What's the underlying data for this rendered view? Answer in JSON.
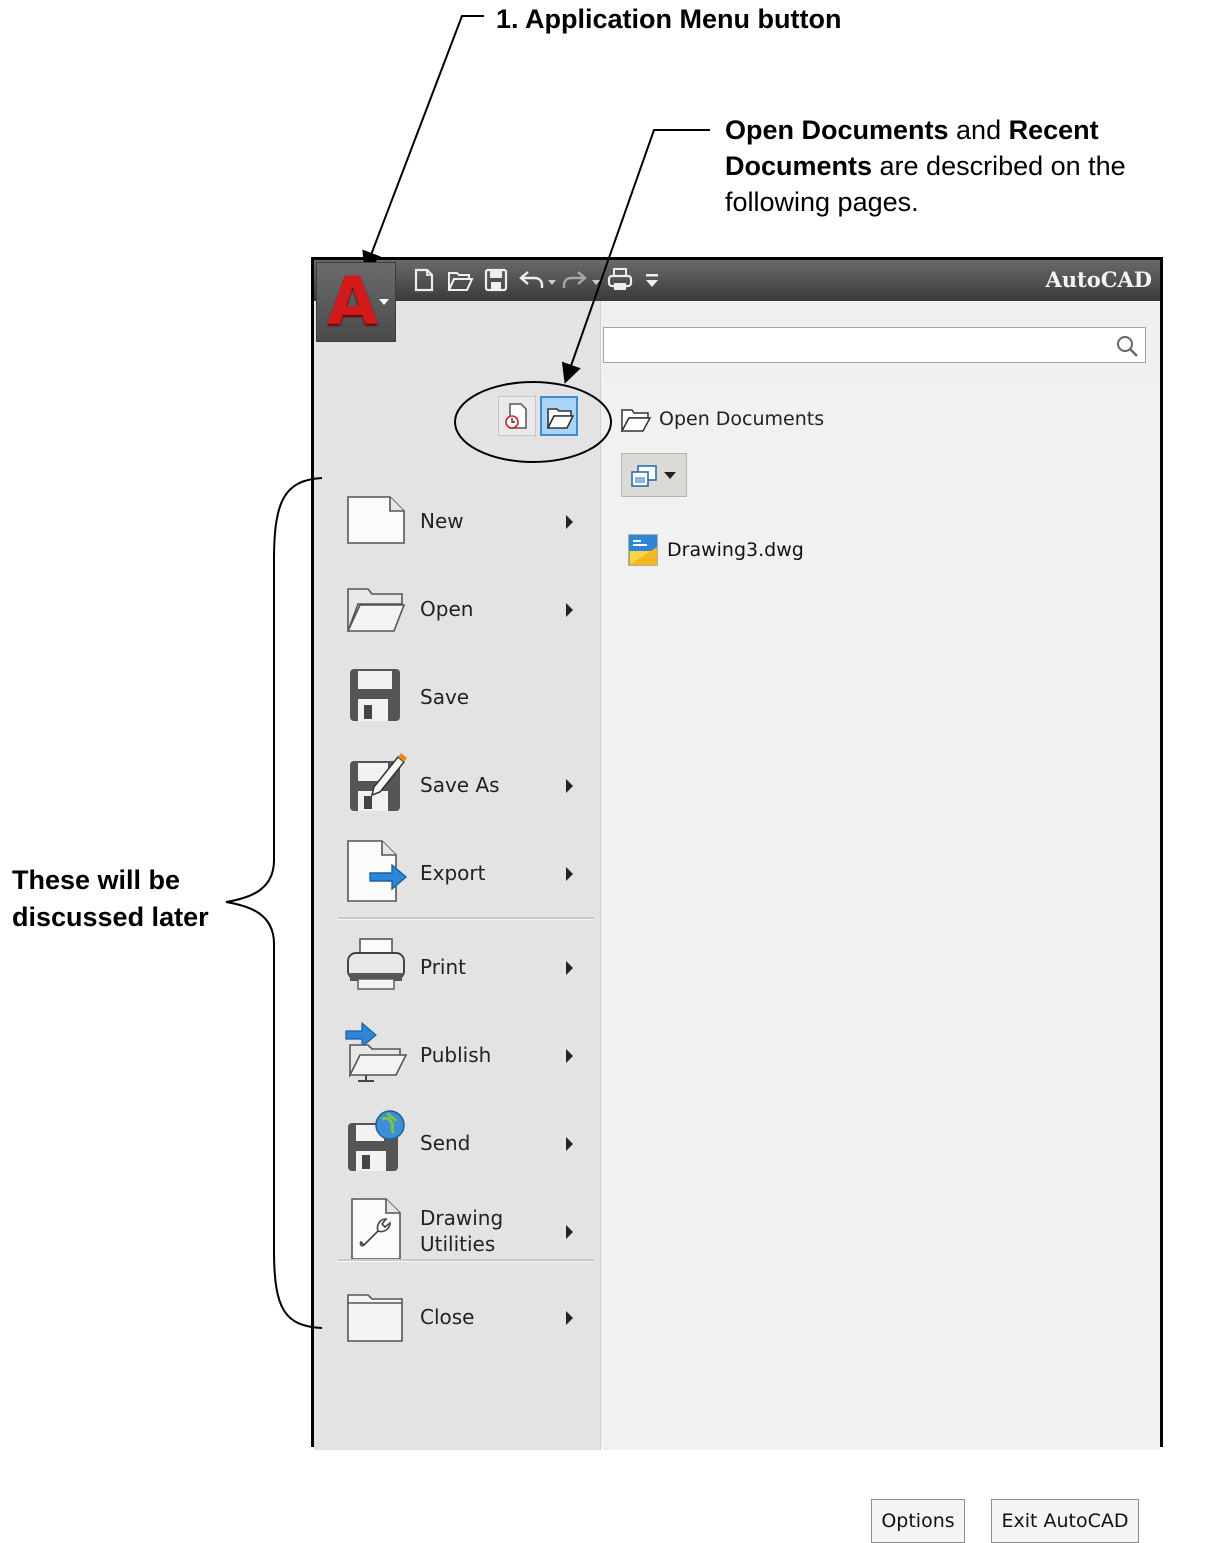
{
  "annotations": {
    "app_menu_callout": "1.  Application Menu button",
    "docs_callout": {
      "part1_bold": "Open Documents",
      "part2": " and ",
      "part3_bold": "Recent Documents",
      "part4": " are described on the following pages."
    },
    "left_note": "These will be discussed later"
  },
  "window": {
    "title": "AutoCAD",
    "app_button_icon": "autocad-logo-icon",
    "quick_access": [
      "new-icon",
      "open-icon",
      "save-icon",
      "undo-icon",
      "redo-icon",
      "plot-icon",
      "customize-icon"
    ]
  },
  "view_toggle": {
    "recent_icon": "recent-documents-icon",
    "open_icon": "open-documents-icon"
  },
  "menu": {
    "items": [
      {
        "label": "New",
        "icon": "new-document-icon",
        "submenu": true
      },
      {
        "label": "Open",
        "icon": "open-folder-icon",
        "submenu": true
      },
      {
        "label": "Save",
        "icon": "save-disk-icon",
        "submenu": false
      },
      {
        "label": "Save As",
        "icon": "save-as-icon",
        "submenu": true
      },
      {
        "label": "Export",
        "icon": "export-icon",
        "submenu": true
      },
      {
        "label": "Print",
        "icon": "printer-icon",
        "submenu": true
      },
      {
        "label": "Publish",
        "icon": "publish-icon",
        "submenu": true
      },
      {
        "label": "Send",
        "icon": "send-icon",
        "submenu": true
      },
      {
        "label": "Drawing Utilities",
        "label_line1": "Drawing",
        "label_line2": "Utilities",
        "icon": "drawing-utilities-icon",
        "submenu": true
      },
      {
        "label": "Close",
        "icon": "close-folder-icon",
        "submenu": true
      }
    ]
  },
  "search": {
    "placeholder": "",
    "icon": "search-icon"
  },
  "documents_panel": {
    "header": "Open Documents",
    "view_dropdown_icon": "icon-view-icon",
    "files": [
      {
        "name": "Drawing3.dwg",
        "icon": "dwg-file-icon"
      }
    ]
  },
  "footer": {
    "options_label": "Options",
    "exit_label": "Exit AutoCAD"
  },
  "colors": {
    "title_bar": "#4a4a4a",
    "selected_toggle": "#a9d4f5",
    "logo_red": "#d31a1a"
  }
}
